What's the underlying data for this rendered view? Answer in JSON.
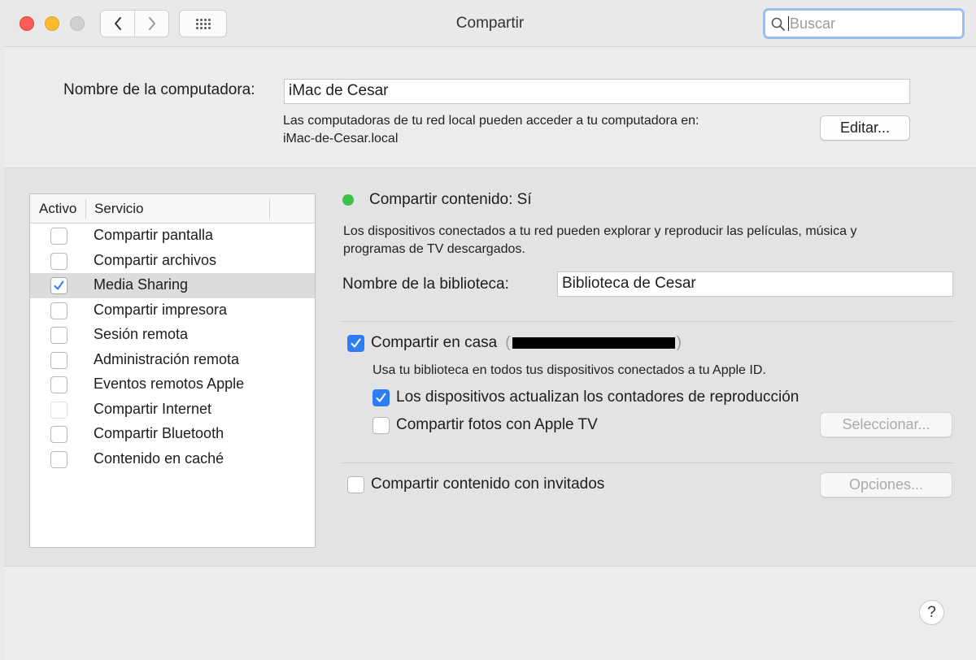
{
  "window": {
    "title": "Compartir",
    "search_placeholder": "Buscar"
  },
  "computer_name": {
    "label": "Nombre de la computadora:",
    "value": "iMac de Cesar",
    "description_line1": "Las computadoras de tu red local pueden acceder a tu computadora en:",
    "description_line2": "iMac-de-Cesar.local",
    "edit_button": "Editar..."
  },
  "services": {
    "header_active": "Activo",
    "header_service": "Servicio",
    "items": [
      {
        "label": "Compartir pantalla",
        "checked": false
      },
      {
        "label": "Compartir archivos",
        "checked": false
      },
      {
        "label": "Media Sharing",
        "checked": true,
        "selected": true
      },
      {
        "label": "Compartir impresora",
        "checked": false
      },
      {
        "label": "Sesión remota",
        "checked": false
      },
      {
        "label": "Administración remota",
        "checked": false
      },
      {
        "label": "Eventos remotos Apple",
        "checked": false
      },
      {
        "label": "Compartir Internet",
        "checked": false
      },
      {
        "label": "Compartir Bluetooth",
        "checked": false
      },
      {
        "label": "Contenido en caché",
        "checked": false
      }
    ]
  },
  "media": {
    "status": "Compartir contenido: Sí",
    "status_color": "#3fc24b",
    "description_line1": "Los dispositivos conectados a tu red pueden explorar y reproducir las películas, música y",
    "description_line2": "programas de TV descargados.",
    "library_label": "Nombre de la biblioteca:",
    "library_value": "Biblioteca de Cesar",
    "home_sharing_label": "Compartir en casa",
    "home_sharing_paren_open": "(",
    "home_sharing_paren_close": ")",
    "home_sharing_desc": "Usa tu biblioteca en todos tus dispositivos conectados a tu Apple ID.",
    "playcount_label": "Los dispositivos actualizan los contadores de reproducción",
    "photos_label": "Compartir fotos con Apple TV",
    "select_button": "Seleccionar...",
    "guests_label": "Compartir contenido con invitados",
    "options_button": "Opciones..."
  },
  "help_label": "?",
  "accent_color": "#2f7df6"
}
